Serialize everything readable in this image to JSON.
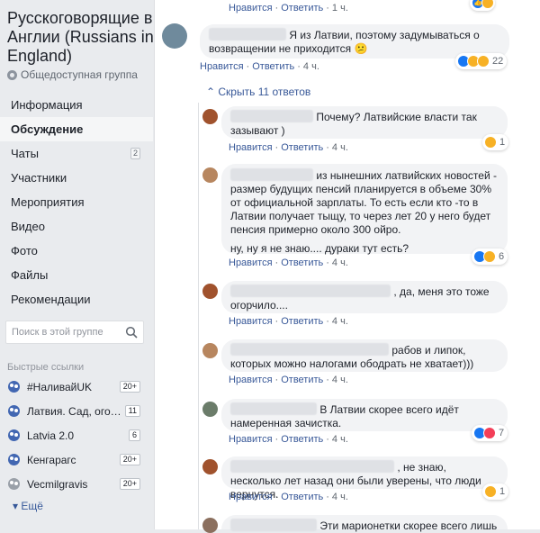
{
  "group": {
    "title": "Русскоговорящие в Англии (Russians in England)",
    "privacy": "Общедоступная группа"
  },
  "nav": [
    {
      "label": "Информация",
      "badge": ""
    },
    {
      "label": "Обсуждение",
      "badge": "",
      "active": true
    },
    {
      "label": "Чаты",
      "badge": "2"
    },
    {
      "label": "Участники",
      "badge": ""
    },
    {
      "label": "Мероприятия",
      "badge": ""
    },
    {
      "label": "Видео",
      "badge": ""
    },
    {
      "label": "Фото",
      "badge": ""
    },
    {
      "label": "Файлы",
      "badge": ""
    },
    {
      "label": "Рекомендации",
      "badge": ""
    }
  ],
  "search": {
    "placeholder": "Поиск в этой группе"
  },
  "quick_links": {
    "title": "Быстрые ссылки",
    "items": [
      {
        "label": "#НаливайUK",
        "badge": "20+"
      },
      {
        "label": "Латвия. Сад, огоро...",
        "badge": "11"
      },
      {
        "label": "Latvia 2.0",
        "badge": "6"
      },
      {
        "label": "Кенгарагс",
        "badge": "20+"
      },
      {
        "label": "Vecmilgravis",
        "badge": "20+"
      }
    ],
    "more": "Ещё"
  },
  "actions": {
    "like": "Нравится",
    "reply": "Ответить",
    "sep": "·"
  },
  "top_comment_prev": {
    "time": "1 ч."
  },
  "top_comment_prev_reacts": {
    "count": ""
  },
  "main_comment": {
    "text": "Я из Латвии, поэтому задумываться о возвращении не приходится 😕",
    "time": "4 ч.",
    "reacts": "22"
  },
  "replies_toggle": "Скрыть 11 ответов",
  "replies": [
    {
      "text": "Почему? Латвийские власти так зазывают )",
      "time": "4 ч.",
      "reacts": "1"
    },
    {
      "text": "из нынешних латвийских новостей - размер будущих пенсий планируется в объеме 30% от официальной зарплаты. То есть если кто -то в Латвии получает тыщу, то через лет 20 у него будет пенсия примерно около 300 ойро.",
      "text2": "ну, ну я не знаю.... дураки тут есть?",
      "time": "4 ч.",
      "reacts": "6"
    },
    {
      "text": ", да, меня это тоже огорчило....",
      "time": "4 ч.",
      "reacts": ""
    },
    {
      "text": "рабов и липок, которых можно налогами ободрать не хватает)))",
      "time": "4 ч.",
      "reacts": ""
    },
    {
      "text": "В Латвии скорее всего идёт намеренная зачистка.",
      "time": "4 ч.",
      "reacts": "7"
    },
    {
      "text": ", не знаю, несколько лет назад они были уверены, что люди вернутся.",
      "time": "4 ч.",
      "reacts": "1"
    },
    {
      "text": "Эти марионетки скорее всего лишь",
      "time": "",
      "reacts": ""
    }
  ]
}
